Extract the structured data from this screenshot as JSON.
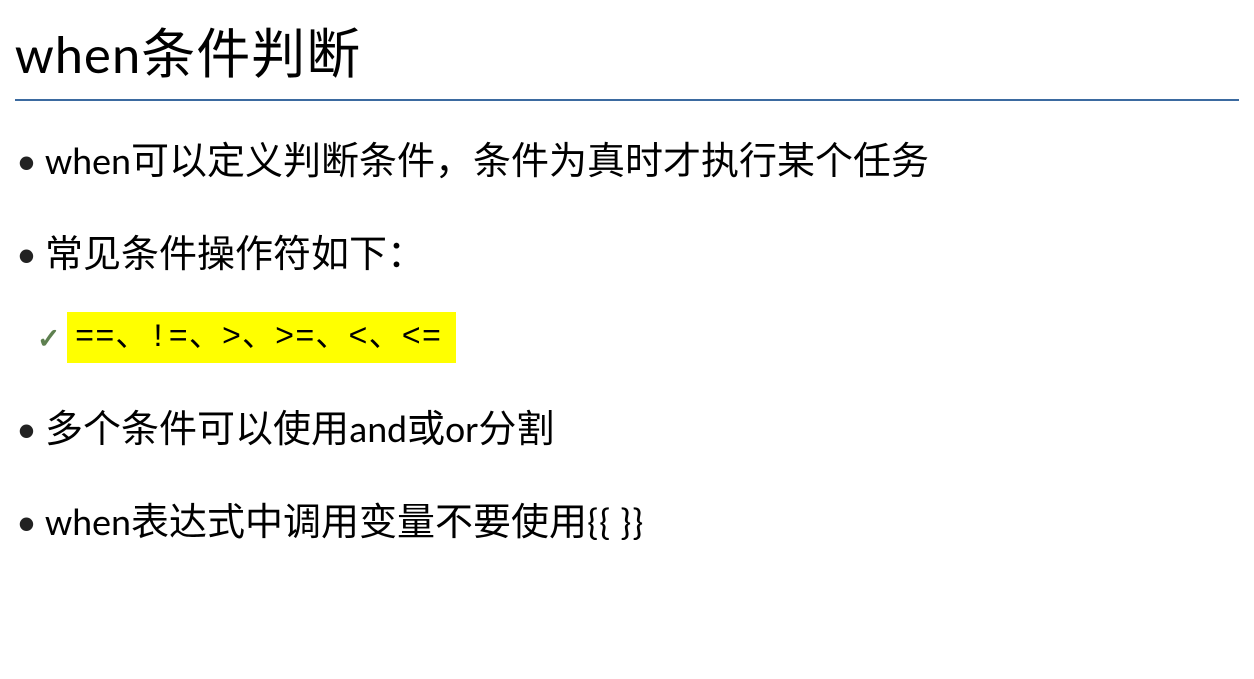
{
  "title": "when条件判断",
  "bullets": [
    "when可以定义判断条件，条件为真时才执行某个任务",
    "常见条件操作符如下：",
    "多个条件可以使用and或or分割",
    "when表达式中调用变量不要使用{{  }}"
  ],
  "operators_line": "==、!=、>、>=、<、<=",
  "highlight_color": "#ffff00",
  "divider_color": "#3b6aa0"
}
